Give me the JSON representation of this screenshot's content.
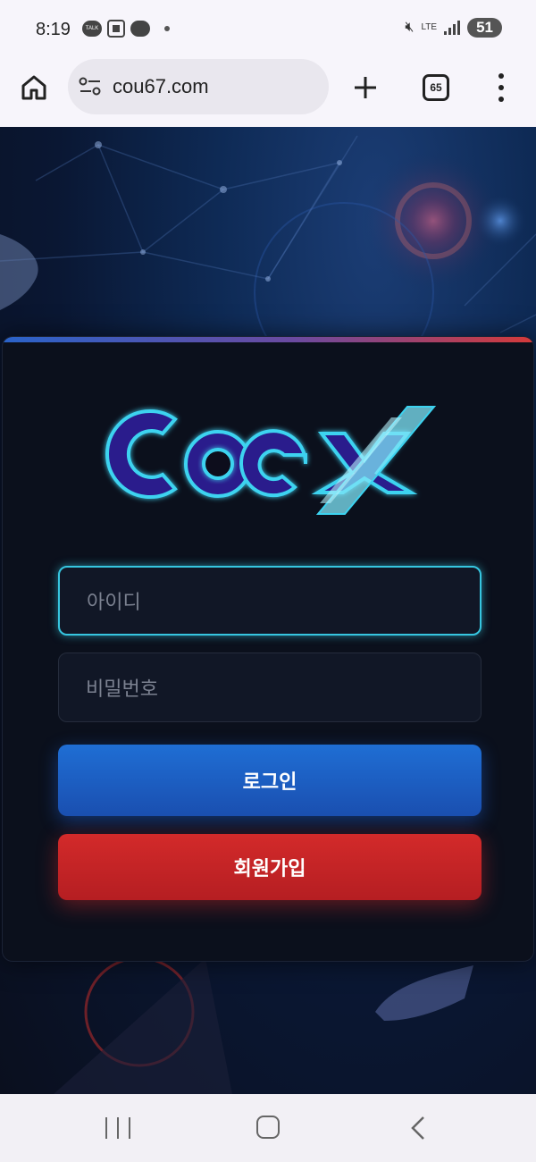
{
  "status_bar": {
    "time": "8:19",
    "talk_label": "TALK",
    "lte_label": "LTE",
    "battery": "51"
  },
  "browser": {
    "url": "cou67.com",
    "tab_count": "65"
  },
  "login": {
    "logo_text": "Coex",
    "id_placeholder": "아이디",
    "password_placeholder": "비밀번호",
    "login_button": "로그인",
    "join_button": "회원가입"
  },
  "colors": {
    "login_button": "#1f6ed4",
    "join_button": "#c72427",
    "logo_blue": "#2a1a8c",
    "logo_glow": "#3cd3f0"
  },
  "icons": [
    "home-icon",
    "site-settings-icon",
    "plus-icon",
    "tabs-icon",
    "more-icon",
    "recent-apps-icon",
    "nav-home-icon",
    "back-icon"
  ]
}
